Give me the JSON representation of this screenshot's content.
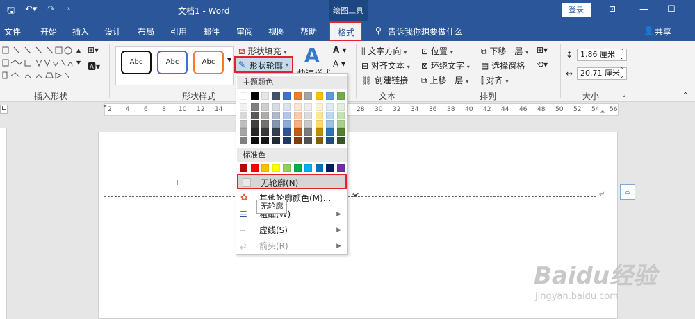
{
  "titlebar": {
    "doc_title": "文档1 - Word",
    "context_label": "绘图工具",
    "login_button": "登录"
  },
  "tabs": [
    "文件",
    "开始",
    "插入",
    "设计",
    "布局",
    "引用",
    "邮件",
    "审阅",
    "视图",
    "帮助",
    "格式"
  ],
  "tell_me": "告诉我你想要做什么",
  "share": "共享",
  "ribbon": {
    "groups": [
      "插入形状",
      "形状样式",
      "文本",
      "排列",
      "大小"
    ],
    "style_sample": "Abc",
    "shape_fill": "形状填充",
    "shape_outline": "形状轮廓",
    "quick_styles": "快速样式",
    "text_direction": "文字方向",
    "align_text": "对齐文本",
    "create_link": "创建链接",
    "position": "位置",
    "wrap_text": "环绕文字",
    "bring_forward": "上移一层",
    "send_backward": "下移一层",
    "selection_pane": "选择窗格",
    "align": "对齐",
    "height": "1.86 厘米",
    "width": "20.71 厘米"
  },
  "ruler": {
    "ticks": [
      "2",
      "4",
      "6",
      "8",
      "10",
      "12",
      "14",
      "28",
      "30",
      "32",
      "34",
      "36",
      "38",
      "40",
      "42",
      "44",
      "46",
      "48",
      "50",
      "52",
      "54",
      "56"
    ]
  },
  "menu": {
    "theme_colors_label": "主题颜色",
    "standard_colors_label": "标准色",
    "no_outline": "无轮廓(N)",
    "more_colors": "其他轮廓颜色(M)...",
    "weight": "粗细(W)",
    "dashes": "虚线(S)",
    "arrows": "箭头(R)",
    "theme_top": [
      "#ffffff",
      "#000000",
      "#e7e6e6",
      "#44546a",
      "#4472c4",
      "#ed7d31",
      "#a5a5a5",
      "#ffc000",
      "#5b9bd5",
      "#70ad47"
    ],
    "theme_shades": [
      [
        "#f2f2f2",
        "#7f7f7f",
        "#d0cece",
        "#d6dce4",
        "#d9e2f3",
        "#fbe5d5",
        "#ededed",
        "#fff2cc",
        "#deebf6",
        "#e2efd9"
      ],
      [
        "#d8d8d8",
        "#595959",
        "#aeabab",
        "#adb9ca",
        "#b4c6e7",
        "#f7caac",
        "#dbdbdb",
        "#fee599",
        "#bdd7ee",
        "#c5e0b3"
      ],
      [
        "#bfbfbf",
        "#3f3f3f",
        "#767171",
        "#8496b0",
        "#8eaadb",
        "#f4b183",
        "#c9c9c9",
        "#ffd965",
        "#9cc3e5",
        "#a8d08d"
      ],
      [
        "#a5a5a5",
        "#262626",
        "#3a3838",
        "#323f4f",
        "#2f5496",
        "#c55a11",
        "#7b7b7b",
        "#bf8f00",
        "#2e75b5",
        "#538135"
      ],
      [
        "#7f7f7f",
        "#0c0c0c",
        "#171616",
        "#222a35",
        "#1f3864",
        "#833c0b",
        "#525252",
        "#7f6000",
        "#1e4e79",
        "#375623"
      ]
    ],
    "standard": [
      "#c00000",
      "#ff0000",
      "#ffc000",
      "#ffff00",
      "#92d050",
      "#00b050",
      "#00b0f0",
      "#0070c0",
      "#002060",
      "#7030a0"
    ]
  },
  "tooltip": "无轮廓",
  "watermark": {
    "brand": "Baidu经验",
    "url": "jingyan.baidu.com"
  },
  "colors": {
    "title_blue": "#2b579a",
    "highlight_red": "#e0242e"
  }
}
